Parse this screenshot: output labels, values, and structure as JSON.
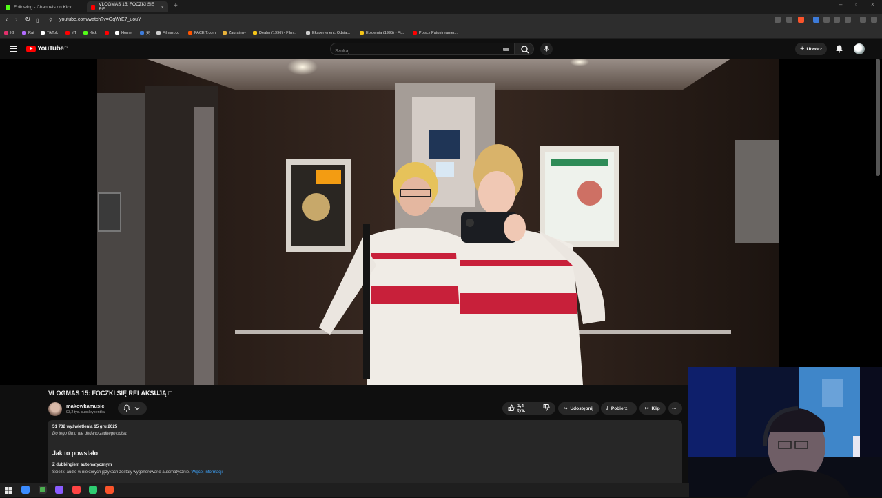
{
  "browser": {
    "tabs": [
      {
        "label": "Following - Channels on Kick",
        "active": false,
        "favicon_color": "#53fc18"
      },
      {
        "label": "VLOGMAS 15: FOCZKI SIĘ RE",
        "active": true,
        "favicon_color": "#ff0000"
      }
    ],
    "url": "youtube.com/watch?v=GqWrE7_uouY",
    "bookmarks": [
      {
        "label": "IG",
        "color": "#e1306c"
      },
      {
        "label": "Rat",
        "color": "#b36bff"
      },
      {
        "label": "TikTok",
        "color": "#ffffff"
      },
      {
        "label": "YT",
        "color": "#ff0000"
      },
      {
        "label": "Kick",
        "color": "#53fc18"
      },
      {
        "label": "",
        "color": "#ff0000"
      },
      {
        "label": "Home",
        "color": "#ffffff"
      },
      {
        "label": "",
        "color": "#3d7bd9"
      },
      {
        "label": "Filman.cc",
        "color": "#cccccc"
      },
      {
        "label": "FACEIT.com",
        "color": "#ff5500"
      },
      {
        "label": "Zagraj.my",
        "color": "#e8b23a"
      },
      {
        "label": "Dealer (1996) - Film...",
        "color": "#f5c518"
      },
      {
        "label": "Eksperyment: Odsia...",
        "color": "#cccccc"
      },
      {
        "label": "Epidemia (1995) - Fi...",
        "color": "#f5c518"
      },
      {
        "label": "Polscy Patostreamer...",
        "color": "#ff0000"
      }
    ]
  },
  "youtube": {
    "logo_text": "YouTube",
    "country_code": "PL",
    "search_placeholder": "Szukaj",
    "create_label": "Utwórz",
    "video": {
      "title": "VLOGMAS 15: FOCZKI SIĘ RELAKSUJĄ □",
      "channel_name": "makowkamusic",
      "subscribers": "93,2 tys. subskrybentów",
      "likes": "1,4 tys.",
      "share_label": "Udostępnij",
      "download_label": "Pobierz",
      "clip_label": "Klip",
      "stats": "51 732 wyświetlenia  15 gru 2025",
      "no_description": "Do tego filmu nie dodano żadnego opisu.",
      "how_made_heading": "Jak to powstało",
      "dubbing_heading": "Z dubbingiem automatycznym",
      "dubbing_text": "Ścieżki audio w niektórych językach zostały wygenerowane automatycznie.",
      "more_info_link": "Więcej informacji"
    }
  },
  "taskbar": {
    "icons": [
      {
        "name": "windows-start-icon",
        "color": "#3aa0ff"
      },
      {
        "name": "app-icon-1",
        "color": "#3b8cff"
      },
      {
        "name": "chrome-icon",
        "color": "#4caf50"
      },
      {
        "name": "app-icon-2",
        "color": "#8a5cff"
      },
      {
        "name": "app-icon-3",
        "color": "#ff4444"
      },
      {
        "name": "app-icon-4",
        "color": "#2ecc71"
      },
      {
        "name": "brave-icon",
        "color": "#fb542b"
      }
    ]
  }
}
